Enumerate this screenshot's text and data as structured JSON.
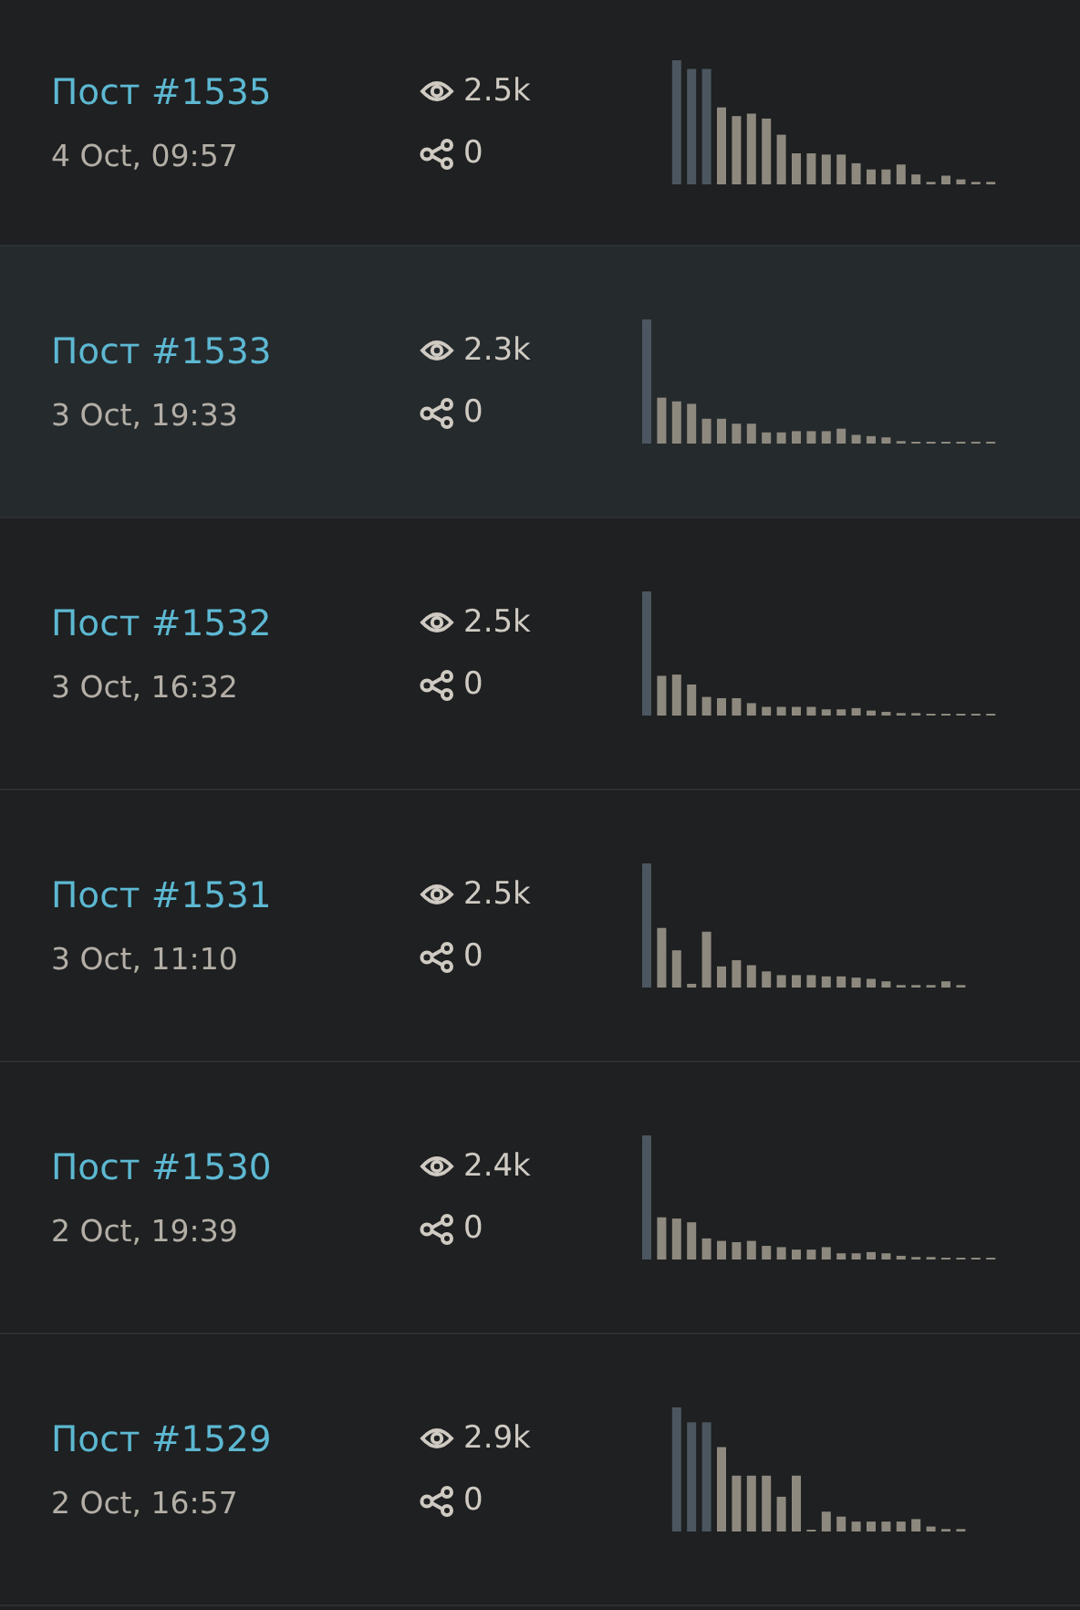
{
  "posts": [
    {
      "title": "Пост #1535",
      "date": "4 Oct, 09:57",
      "views": "2.5k",
      "shares": "0",
      "selected": false
    },
    {
      "title": "Пост #1533",
      "date": "3 Oct, 19:33",
      "views": "2.3k",
      "shares": "0",
      "selected": true
    },
    {
      "title": "Пост #1532",
      "date": "3 Oct, 16:32",
      "views": "2.5k",
      "shares": "0",
      "selected": false
    },
    {
      "title": "Пост #1531",
      "date": "3 Oct, 11:10",
      "views": "2.5k",
      "shares": "0",
      "selected": false
    },
    {
      "title": "Пост #1530",
      "date": "2 Oct, 19:39",
      "views": "2.4k",
      "shares": "0",
      "selected": false
    },
    {
      "title": "Пост #1529",
      "date": "2 Oct, 16:57",
      "views": "2.9k",
      "shares": "0",
      "selected": false
    }
  ]
}
